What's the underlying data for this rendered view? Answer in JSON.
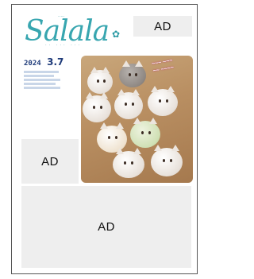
{
  "ads": {
    "top": "AD",
    "left": "AD",
    "bottom": "AD"
  },
  "magazine": {
    "logo": "Salala",
    "year": "2024",
    "month": "3.7",
    "colors": {
      "logo": "#38a6b0",
      "issue": "#1f3b7a",
      "ad_background": "#eeeeee",
      "border": "#555555"
    }
  },
  "cover_photo": {
    "subject": "cat-shaped bun sweets",
    "icon": "cover-photo"
  }
}
